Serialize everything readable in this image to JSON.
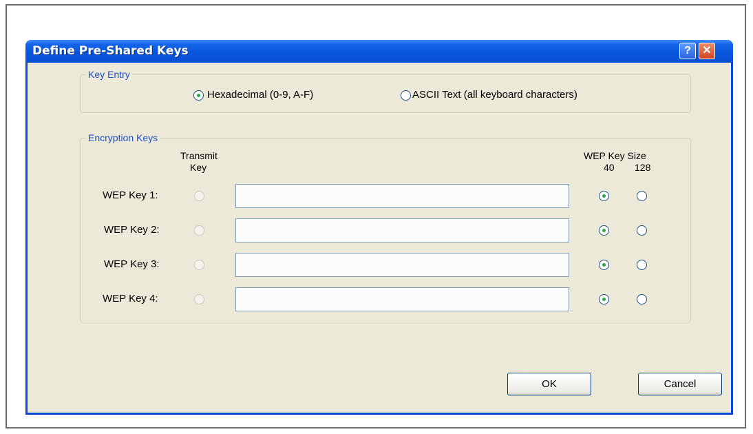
{
  "window": {
    "title": "Define Pre-Shared Keys",
    "help_glyph": "?",
    "close_glyph": "✕"
  },
  "key_entry": {
    "legend": "Key Entry",
    "options": [
      {
        "label": "Hexadecimal (0-9, A-F)",
        "selected": true
      },
      {
        "label": "ASCII Text (all keyboard characters)",
        "selected": false
      }
    ]
  },
  "encryption_keys": {
    "legend": "Encryption Keys",
    "transmit_header_line1": "Transmit",
    "transmit_header_line2": "Key",
    "size_header": "WEP Key Size",
    "size_40": "40",
    "size_128": "128",
    "rows": [
      {
        "label": "WEP Key 1:",
        "value": "",
        "size": "40"
      },
      {
        "label": "WEP Key 2:",
        "value": "",
        "size": "40"
      },
      {
        "label": "WEP Key 3:",
        "value": "",
        "size": "40"
      },
      {
        "label": "WEP Key 4:",
        "value": "",
        "size": "40"
      }
    ]
  },
  "buttons": {
    "ok": "OK",
    "cancel": "Cancel"
  },
  "colors": {
    "titlebar": "#0a4fd4",
    "client": "#ece9d8",
    "legend_text": "#1c4fc3",
    "radio_dot": "#2ea34a"
  }
}
